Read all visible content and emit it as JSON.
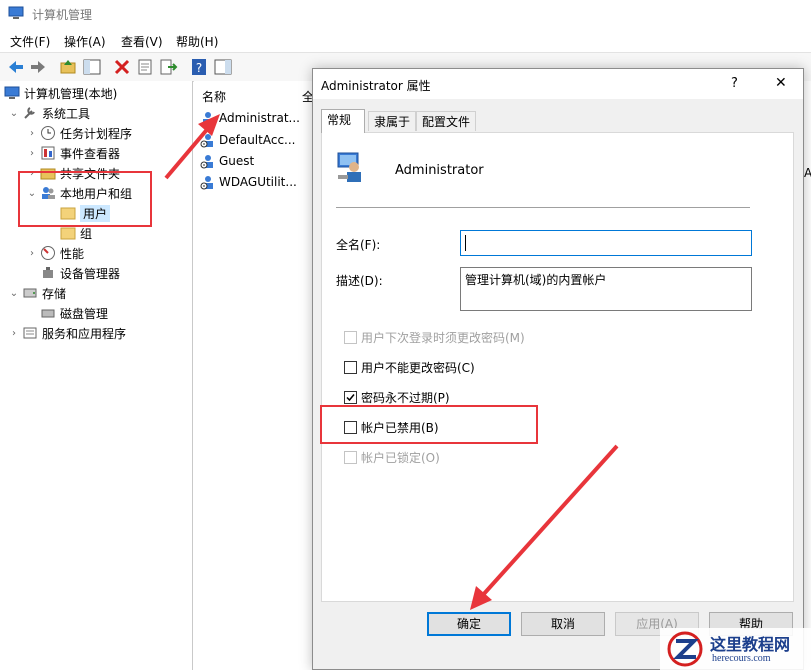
{
  "window": {
    "title": "计算机管理"
  },
  "menu": [
    "文件(F)",
    "操作(A)",
    "查看(V)",
    "帮助(H)"
  ],
  "tree": {
    "root": "计算机管理(本地)",
    "system_tools": "系统工具",
    "task_scheduler": "任务计划程序",
    "event_viewer": "事件查看器",
    "shared_folders": "共享文件夹",
    "local_users_groups": "本地用户和组",
    "users": "用户",
    "groups": "组",
    "performance": "性能",
    "device_manager": "设备管理器",
    "storage": "存储",
    "disk_management": "磁盘管理",
    "services_apps": "服务和应用程序"
  },
  "list": {
    "col_name": "名称",
    "col_fullname_partial": "全",
    "users": [
      "Administrat...",
      "DefaultAcc...",
      "Guest",
      "WDAGUtilit..."
    ]
  },
  "right_pane": {
    "partial_a": "A"
  },
  "dialog": {
    "title": "Administrator 属性",
    "help": "?",
    "close": "✕",
    "tabs": [
      "常规",
      "隶属于",
      "配置文件"
    ],
    "username": "Administrator",
    "fullname_label": "全名(F):",
    "fullname_value": "",
    "description_label": "描述(D):",
    "description_value": "管理计算机(域)的内置帐户",
    "options": [
      {
        "label": "用户下次登录时须更改密码(M)",
        "checked": false,
        "disabled": true
      },
      {
        "label": "用户不能更改密码(C)",
        "checked": false,
        "disabled": false
      },
      {
        "label": "密码永不过期(P)",
        "checked": true,
        "disabled": false
      },
      {
        "label": "帐户已禁用(B)",
        "checked": false,
        "disabled": false
      },
      {
        "label": "帐户已锁定(O)",
        "checked": false,
        "disabled": true
      }
    ],
    "buttons": {
      "ok": "确定",
      "cancel": "取消",
      "apply": "应用(A)",
      "help": "帮助"
    }
  },
  "watermark": {
    "name": "这里教程网",
    "url": "herecours.com"
  },
  "colors": {
    "annotation_red": "#e8353b",
    "selection": "#cce8ff",
    "focus_blue": "#0078d7"
  }
}
